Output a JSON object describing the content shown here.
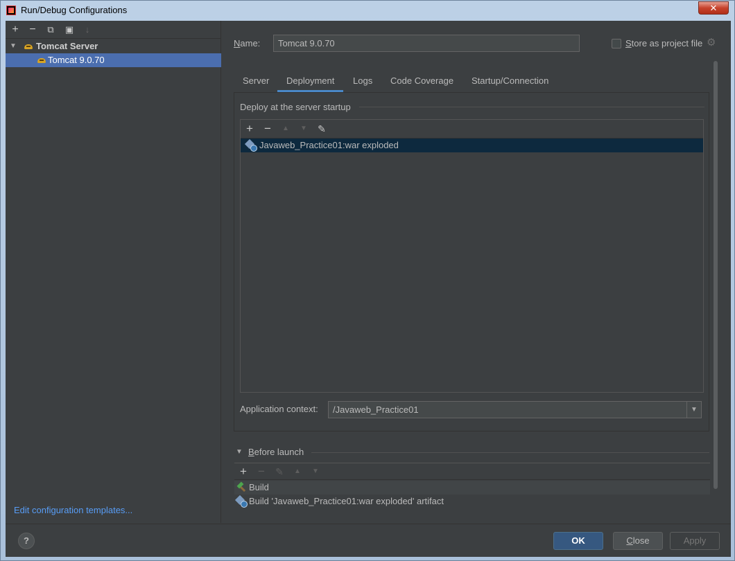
{
  "window": {
    "title": "Run/Debug Configurations",
    "close_glyph": "✕"
  },
  "left": {
    "toolbar": {
      "add": "+",
      "remove": "−",
      "copy": "⧉",
      "folder": "▣",
      "sort": "↓"
    },
    "tree": {
      "group_label": "Tomcat Server",
      "item_label": "Tomcat 9.0.70"
    },
    "edit_templates": "Edit configuration templates..."
  },
  "form": {
    "name_label": "Name:",
    "name_value": "Tomcat 9.0.70",
    "store_label": "Store as project file",
    "store_checked": false
  },
  "tabs": [
    "Server",
    "Deployment",
    "Logs",
    "Code Coverage",
    "Startup/Connection"
  ],
  "active_tab": "Deployment",
  "deployment": {
    "section_title": "Deploy at the server startup",
    "toolbar": {
      "add": "+",
      "remove": "−",
      "up": "▲",
      "down": "▼",
      "edit": "✎"
    },
    "items": [
      "Javaweb_Practice01:war exploded"
    ],
    "context_label": "Application context:",
    "context_value": "/Javaweb_Practice01"
  },
  "before_launch": {
    "title": "Before launch",
    "toolbar": {
      "add": "+",
      "remove": "−",
      "edit": "✎",
      "up": "▲",
      "down": "▼"
    },
    "items": [
      "Build",
      "Build 'Javaweb_Practice01:war exploded' artifact"
    ]
  },
  "footer": {
    "help": "?",
    "ok": "OK",
    "close": "Close",
    "apply": "Apply"
  },
  "colors": {
    "accent": "#4a88c7",
    "selection": "#4b6eaf",
    "link": "#589df6",
    "background": "#3c3f41"
  }
}
